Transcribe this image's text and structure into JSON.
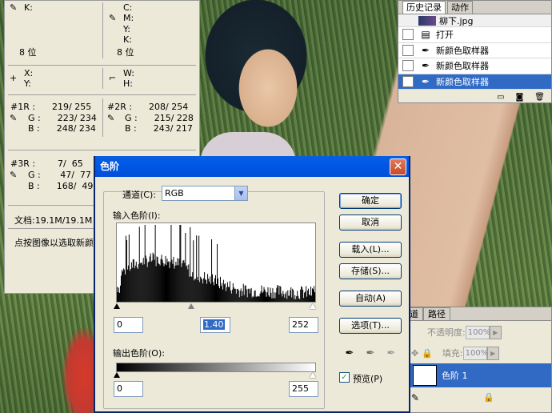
{
  "info_panel": {
    "k_label": "K:",
    "c_label": "C:",
    "m_label": "M:",
    "y_label": "Y:",
    "k2_label": "K:",
    "bits_left": "8 位",
    "bits_right": "8 位",
    "x_label": "X:",
    "y2_label": "Y:",
    "w_label": "W:",
    "h_label": "H:",
    "s1_r": "#1R :      219/ 255",
    "s1_g": "G :      223/ 234",
    "s1_b": "B :      248/ 234",
    "s2_r": "#2R :      208/ 254",
    "s2_g": "G :      215/ 228",
    "s2_b": "B :      243/ 217",
    "s3_r": "#3R :        7/  65",
    "s3_g": "G :       47/  77",
    "s3_b": "B :      168/  49",
    "doc": "文档:19.1M/19.1M",
    "hint": "点按图像以选取新颜"
  },
  "history": {
    "tab_history": "历史记录",
    "tab_actions": "动作",
    "rows": [
      "柳下.jpg",
      "打开",
      "新颜色取样器",
      "新颜色取样器",
      "新颜色取样器"
    ]
  },
  "layers": {
    "tab_channels": "道",
    "tab_paths": "路径",
    "opacity_label": "不透明度:",
    "opacity_value": "100%",
    "fill_label": "填充:",
    "fill_value": "100%",
    "layer_name": "色阶 1"
  },
  "levels": {
    "title": "色阶",
    "channel_label": "通道(C):",
    "channel_value": "RGB",
    "input_label": "输入色阶(I):",
    "input_black": "0",
    "input_gamma": "1.40",
    "input_white": "252",
    "output_label": "输出色阶(O):",
    "output_black": "0",
    "output_white": "255",
    "btn_ok": "确定",
    "btn_cancel": "取消",
    "btn_load": "载入(L)...",
    "btn_save": "存储(S)...",
    "btn_auto": "自动(A)",
    "btn_options": "选项(T)...",
    "preview_label": "预览(P)",
    "preview_checked": true
  }
}
